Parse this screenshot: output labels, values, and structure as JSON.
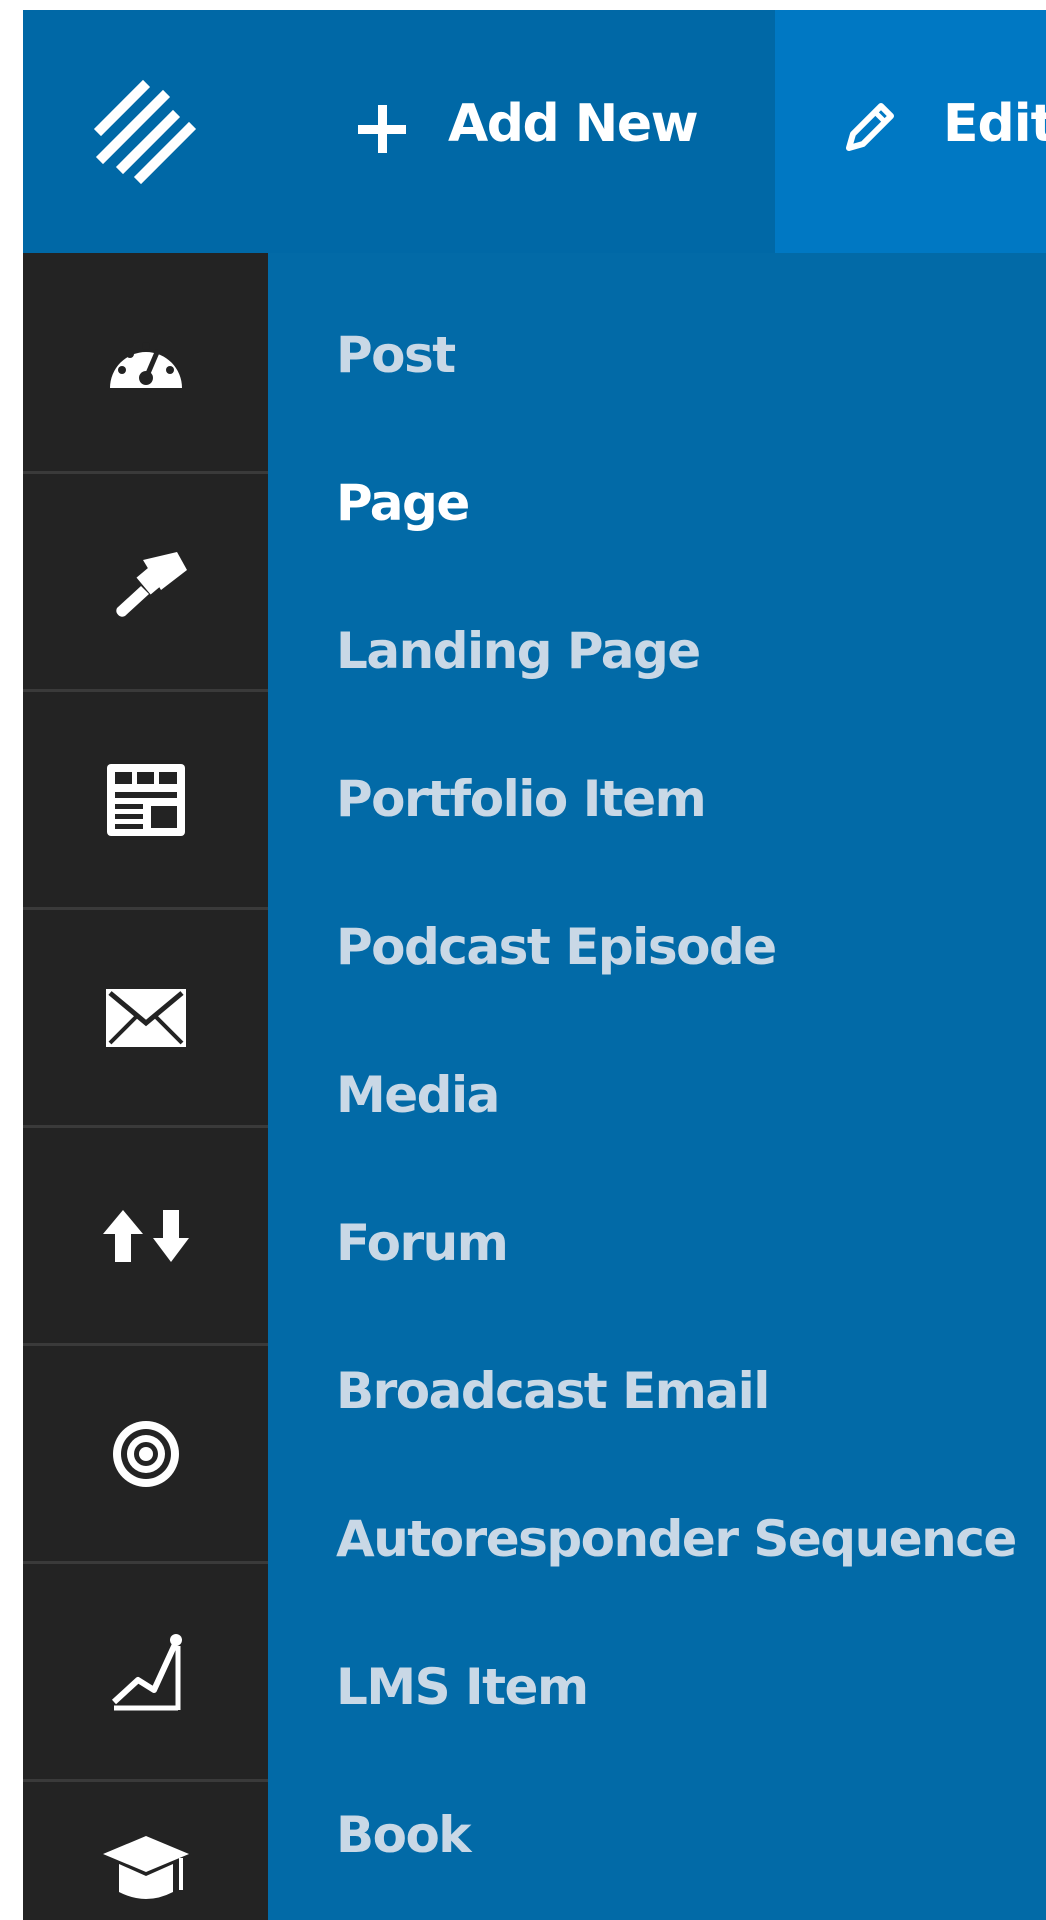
{
  "topbar": {
    "logo_icon": "brand-slashes-icon",
    "add_new": {
      "icon": "plus-icon",
      "label": "Add New"
    },
    "edit": {
      "icon": "pencil-icon",
      "label": "Edit"
    }
  },
  "sidebar_icons": [
    "dashboard-gauge-icon",
    "paintbrush-icon",
    "layout-grid-icon",
    "envelope-icon",
    "up-down-arrows-icon",
    "target-icon",
    "chart-line-icon",
    "graduation-cap-icon"
  ],
  "submenu": {
    "items": [
      {
        "label": "Post"
      },
      {
        "label": "Page",
        "active": true
      },
      {
        "label": "Landing Page"
      },
      {
        "label": "Portfolio Item"
      },
      {
        "label": "Podcast Episode"
      },
      {
        "label": "Media"
      },
      {
        "label": "Forum"
      },
      {
        "label": "Broadcast Email"
      },
      {
        "label": "Autoresponder Sequence"
      },
      {
        "label": "LMS Item"
      },
      {
        "label": "Book"
      }
    ]
  },
  "colors": {
    "topbar": "#0068a6",
    "edit_bg": "#0078c3",
    "submenu_bg": "#026aa7",
    "sidebar_bg": "#232323",
    "submenu_text": "#c9d8e6",
    "submenu_active_text": "#ffffff"
  }
}
